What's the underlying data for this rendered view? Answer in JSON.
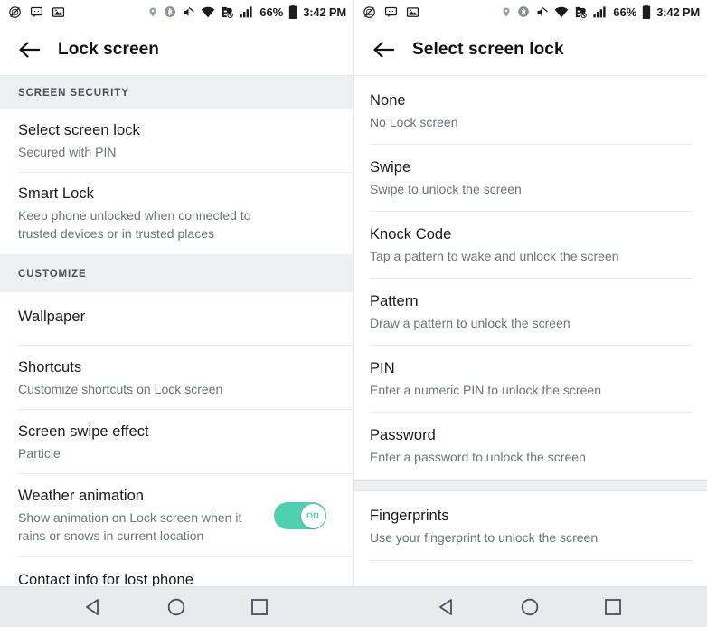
{
  "status_bar": {
    "left_icons": [
      "alarm-muted-icon",
      "message-icon",
      "photo-icon"
    ],
    "right_icons": [
      "location-icon",
      "bluetooth-icon",
      "mute-icon",
      "wifi-icon",
      "data-off-icon",
      "signal-icon"
    ],
    "battery_percent": "66%",
    "battery_icon": "battery-icon",
    "time": "3:42 PM"
  },
  "left_panel": {
    "appbar": {
      "back_icon": "back-arrow-icon",
      "title": "Lock screen"
    },
    "sections": [
      {
        "header": "SCREEN SECURITY",
        "rows": [
          {
            "title": "Select screen lock",
            "sub": "Secured with PIN",
            "toggle": null
          },
          {
            "title": "Smart Lock",
            "sub": "Keep phone unlocked when connected to trusted devices or in trusted places",
            "toggle": null
          }
        ]
      },
      {
        "header": "CUSTOMIZE",
        "rows": [
          {
            "title": "Wallpaper",
            "sub": "",
            "toggle": null
          },
          {
            "title": "Shortcuts",
            "sub": "Customize shortcuts on Lock screen",
            "toggle": null
          },
          {
            "title": "Screen swipe effect",
            "sub": "Particle",
            "toggle": null
          },
          {
            "title": "Weather animation",
            "sub": "Show animation on Lock screen when it rains or snows in current location",
            "toggle": "ON"
          },
          {
            "title": "Contact info for lost phone",
            "sub": "",
            "toggle": null
          }
        ]
      }
    ]
  },
  "right_panel": {
    "appbar": {
      "back_icon": "back-arrow-icon",
      "title": "Select screen lock"
    },
    "options": [
      {
        "title": "None",
        "sub": "No Lock screen"
      },
      {
        "title": "Swipe",
        "sub": "Swipe to unlock the screen"
      },
      {
        "title": "Knock Code",
        "sub": "Tap a pattern to wake and unlock the screen"
      },
      {
        "title": "Pattern",
        "sub": "Draw a pattern to unlock the screen"
      },
      {
        "title": "PIN",
        "sub": "Enter a numeric PIN to unlock the screen"
      },
      {
        "title": "Password",
        "sub": "Enter a password to unlock the screen"
      }
    ],
    "options_after_band": [
      {
        "title": "Fingerprints",
        "sub": "Use your fingerprint to unlock the screen"
      }
    ]
  },
  "nav_bar": {
    "buttons": [
      "back-triangle-icon",
      "home-circle-icon",
      "recents-square-icon"
    ]
  },
  "colors": {
    "toggle_on": "#4fd1b0",
    "section_band": "#eff0f2",
    "nav_bar": "#e9eaee",
    "primary_text": "#1a1a1a",
    "secondary_text": "#6d7278"
  }
}
